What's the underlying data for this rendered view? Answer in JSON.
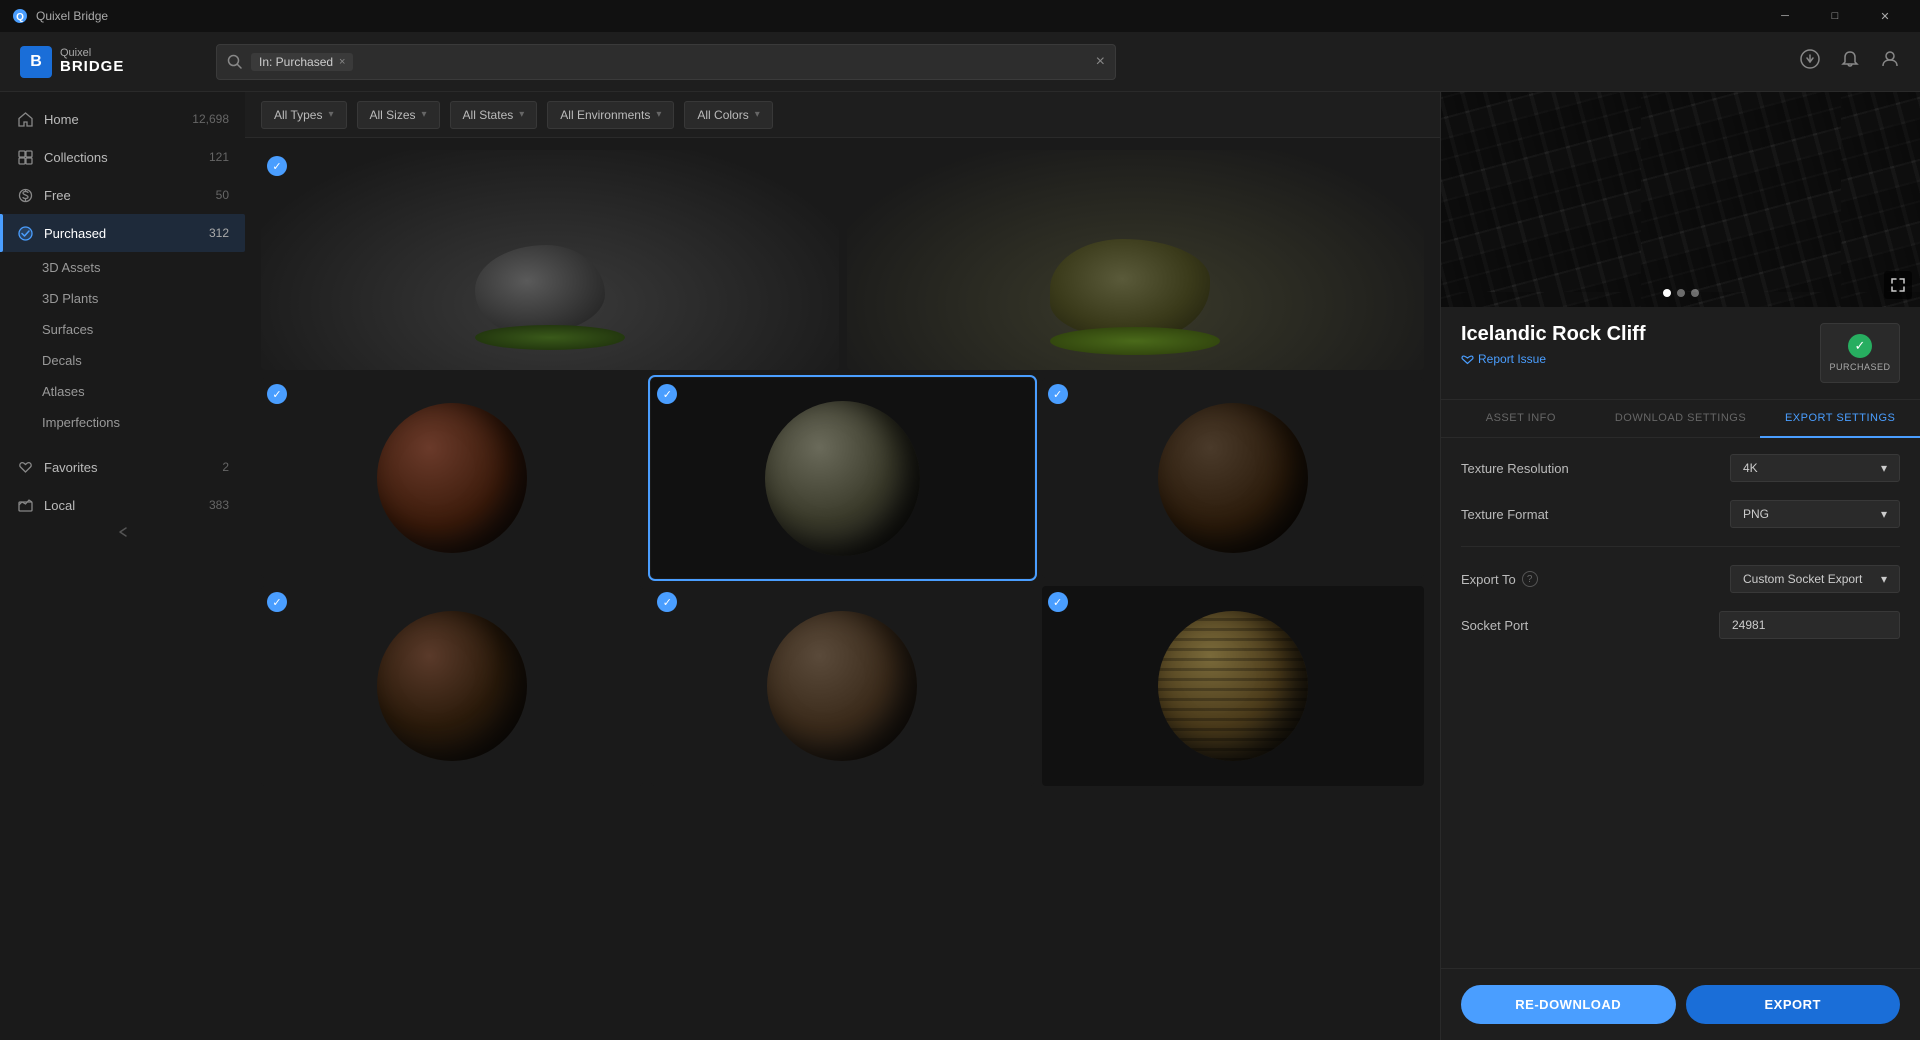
{
  "titlebar": {
    "title": "Quixel Bridge",
    "minimize_label": "─",
    "maximize_label": "□",
    "close_label": "✕"
  },
  "header": {
    "logo_initial": "B",
    "logo_quixel": "Quixel",
    "logo_bridge": "BRIDGE",
    "search_tag": "In: Purchased",
    "search_clear": "×"
  },
  "filters": {
    "types_label": "All Types",
    "sizes_label": "All Sizes",
    "states_label": "All States",
    "environments_label": "All Environments",
    "colors_label": "All Colors"
  },
  "sidebar": {
    "home_label": "Home",
    "home_count": "12,698",
    "collections_label": "Collections",
    "collections_count": "121",
    "free_label": "Free",
    "free_count": "50",
    "purchased_label": "Purchased",
    "purchased_count": "312",
    "sub_3d_assets": "3D Assets",
    "sub_3d_plants": "3D Plants",
    "sub_surfaces": "Surfaces",
    "sub_decals": "Decals",
    "sub_atlases": "Atlases",
    "sub_imperfections": "Imperfections",
    "favorites_label": "Favorites",
    "favorites_count": "2",
    "local_label": "Local",
    "local_count": "383"
  },
  "asset": {
    "title": "Icelandic Rock Cliff",
    "report_label": "Report Issue",
    "purchased_badge": "PURCHASED",
    "tab_asset_info": "ASSET INFO",
    "tab_download_settings": "DOWNLOAD SETTINGS",
    "tab_export_settings": "EXPORT SETTINGS",
    "texture_resolution_label": "Texture Resolution",
    "texture_resolution_value": "4K",
    "texture_format_label": "Texture Format",
    "texture_format_value": "PNG",
    "export_to_label": "Export To",
    "export_to_value": "Custom Socket Export",
    "socket_port_label": "Socket Port",
    "socket_port_value": "24981",
    "redownload_btn": "RE-DOWNLOAD",
    "export_btn": "EXPORT"
  }
}
